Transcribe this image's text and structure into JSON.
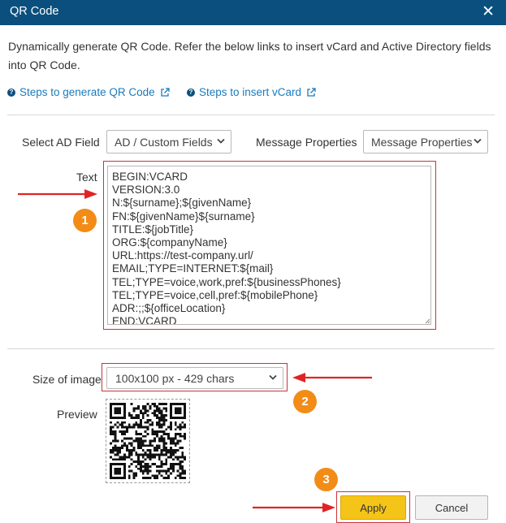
{
  "dialog": {
    "title": "QR Code",
    "close_glyph": "✕",
    "description": "Dynamically generate QR Code. Refer the below links to insert vCard and Active Directory fields into QR Code."
  },
  "links": [
    {
      "label": "Steps to generate QR Code",
      "icon": "question-icon",
      "trailing_icon": "external-link-icon"
    },
    {
      "label": "Steps to insert vCard",
      "icon": "question-icon",
      "trailing_icon": "external-link-icon"
    }
  ],
  "form": {
    "select_ad_label": "Select AD Field",
    "ad_select_value": "AD / Custom Fields",
    "message_properties_label": "Message Properties",
    "message_properties_value": "Message Properties",
    "text_label": "Text",
    "text_value": "BEGIN:VCARD\nVERSION:3.0\nN:${surname};${givenName}\nFN:${givenName}${surname}\nTITLE:${jobTitle}\nORG:${companyName}\nURL:https://test-company.url/\nEMAIL;TYPE=INTERNET:${mail}\nTEL;TYPE=voice,work,pref:${businessPhones}\nTEL;TYPE=voice,cell,pref:${mobilePhone}\nADR:;;${officeLocation}\nEND:VCARD",
    "size_label": "Size of image",
    "size_value": "100x100 px - 429 chars",
    "preview_label": "Preview"
  },
  "annotations": {
    "badges": [
      "1",
      "2",
      "3"
    ],
    "accent_color": "#f28c17",
    "arrow_color": "#e02424",
    "highlight_color": "#c9333b"
  },
  "buttons": {
    "apply": "Apply",
    "cancel": "Cancel"
  },
  "colors": {
    "titlebar": "#0b4f7e",
    "link": "#1a7bbd",
    "apply_bg": "#f5c418"
  }
}
